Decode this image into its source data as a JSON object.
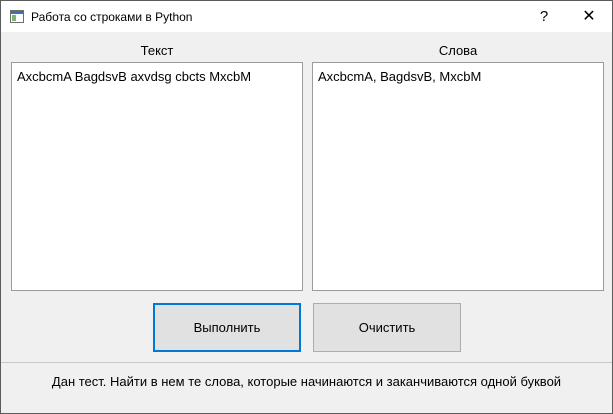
{
  "window": {
    "title": "Работа со строками в Python",
    "help_label": "?",
    "close_label": "✕"
  },
  "labels": {
    "text": "Текст",
    "words": "Слова"
  },
  "inputs": {
    "text_value": "AxcbcmA BagdsvB axvdsg cbcts MxcbM",
    "words_value": "AxcbcmA, BagdsvB, MxcbM"
  },
  "buttons": {
    "run": "Выполнить",
    "clear": "Очистить"
  },
  "status": {
    "task": "Дан тест. Найти в нем те слова, которые начинаются и заканчиваются одной буквой"
  },
  "colors": {
    "accent": "#0078d7"
  }
}
